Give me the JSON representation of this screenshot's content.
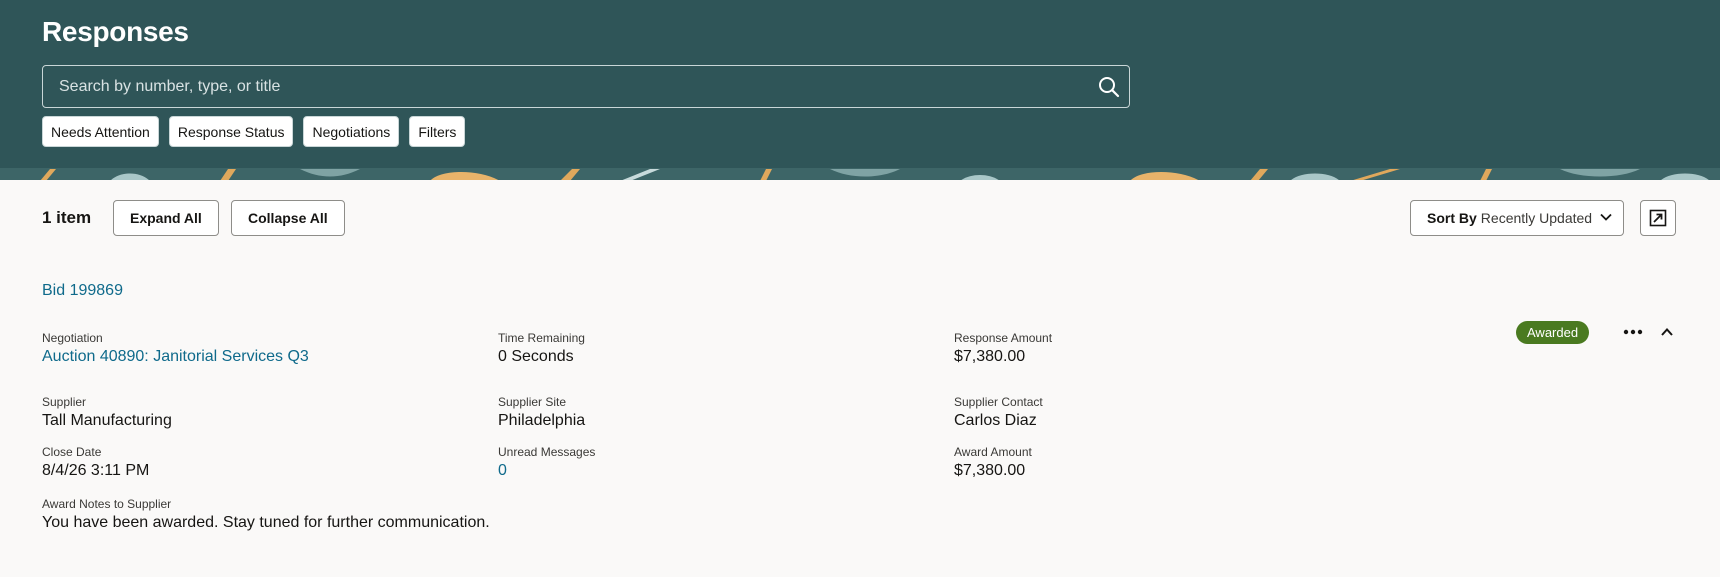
{
  "header": {
    "title": "Responses",
    "search_placeholder": "Search by number, type, or title",
    "filter_chips": [
      "Needs Attention",
      "Response Status",
      "Negotiations",
      "Filters"
    ]
  },
  "toolbar": {
    "item_count": "1 item",
    "expand_all": "Expand All",
    "collapse_all": "Collapse All",
    "sort_by_label": "Sort By",
    "sort_by_value": "Recently Updated"
  },
  "response": {
    "bid": "Bid 199869",
    "status": "Awarded",
    "fields": {
      "negotiation": {
        "label": "Negotiation",
        "value": "Auction 40890: Janitorial Services Q3"
      },
      "time_remaining": {
        "label": "Time Remaining",
        "value": "0 Seconds"
      },
      "response_amount": {
        "label": "Response Amount",
        "value": "$7,380.00"
      },
      "supplier": {
        "label": "Supplier",
        "value": "Tall Manufacturing"
      },
      "supplier_site": {
        "label": "Supplier Site",
        "value": "Philadelphia"
      },
      "supplier_contact": {
        "label": "Supplier Contact",
        "value": "Carlos Diaz"
      },
      "close_date": {
        "label": "Close Date",
        "value": "8/4/26 3:11 PM"
      },
      "unread_messages": {
        "label": "Unread Messages",
        "value": "0"
      },
      "award_amount": {
        "label": "Award Amount",
        "value": "$7,380.00"
      },
      "award_notes": {
        "label": "Award Notes to Supplier",
        "value": "You have been awarded. Stay tuned for further communication."
      }
    }
  },
  "colors": {
    "header_bg": "#2f5558",
    "link": "#0f6a8b",
    "awarded_badge": "#4a7a20",
    "page_bg": "#faf9f8"
  },
  "icons": {
    "search": "search-icon",
    "sort_dropdown": "chevron-down-icon",
    "open_new": "open-in-new-icon",
    "more": "more-actions-icon",
    "collapse": "chevron-up-icon"
  }
}
